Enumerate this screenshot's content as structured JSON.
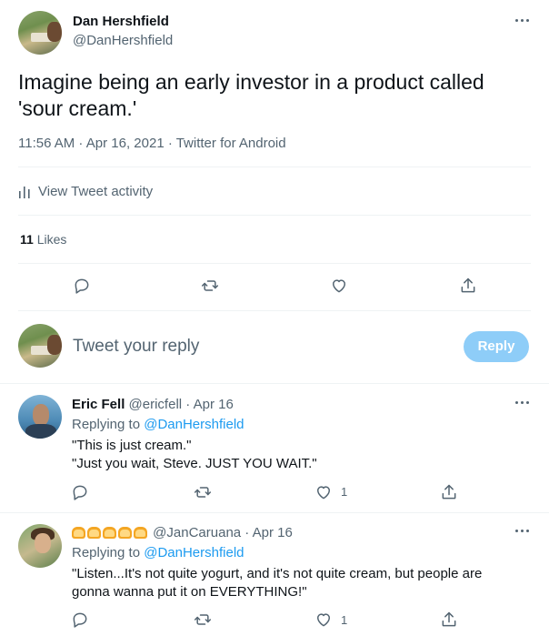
{
  "main_tweet": {
    "author_name": "Dan Hershfield",
    "author_handle": "@DanHershfield",
    "text_line1": "Imagine being an early investor in a product called",
    "text_line2": "'sour cream.'",
    "meta": "11:56 AM · Apr 16, 2021 · Twitter for Android",
    "activity_label": "View Tweet activity",
    "likes_count": "11",
    "likes_label": "Likes"
  },
  "composer": {
    "placeholder": "Tweet your reply",
    "reply_label": "Reply"
  },
  "replies": [
    {
      "name": "Eric Fell",
      "handle": "@ericfell",
      "date": "· Apr 16",
      "replying_prefix": "Replying to",
      "replying_to": "@DanHershfield",
      "line1": "\"This is just cream.\"",
      "line2": "\"Just you wait, Steve. JUST YOU WAIT.\"",
      "like_count": "1"
    },
    {
      "name_emoji": "bread-emoji x5",
      "handle": "@JanCaruana",
      "date": "· Apr 16",
      "replying_prefix": "Replying to",
      "replying_to": "@DanHershfield",
      "line1": "\"Listen...It's not quite yogurt, and it's not quite cream, but people are",
      "line2": "gonna wanna put it on EVERYTHING!\"",
      "like_count": "1"
    }
  ],
  "icons": [
    "reply-icon",
    "retweet-icon",
    "like-icon",
    "share-icon",
    "more-icon",
    "bar-chart-icon",
    "bread-emoji"
  ],
  "colors": {
    "accent": "#1d9bf0",
    "reply_button_disabled": "#8ecdf8",
    "muted": "#536471",
    "divider": "#eff3f4"
  }
}
